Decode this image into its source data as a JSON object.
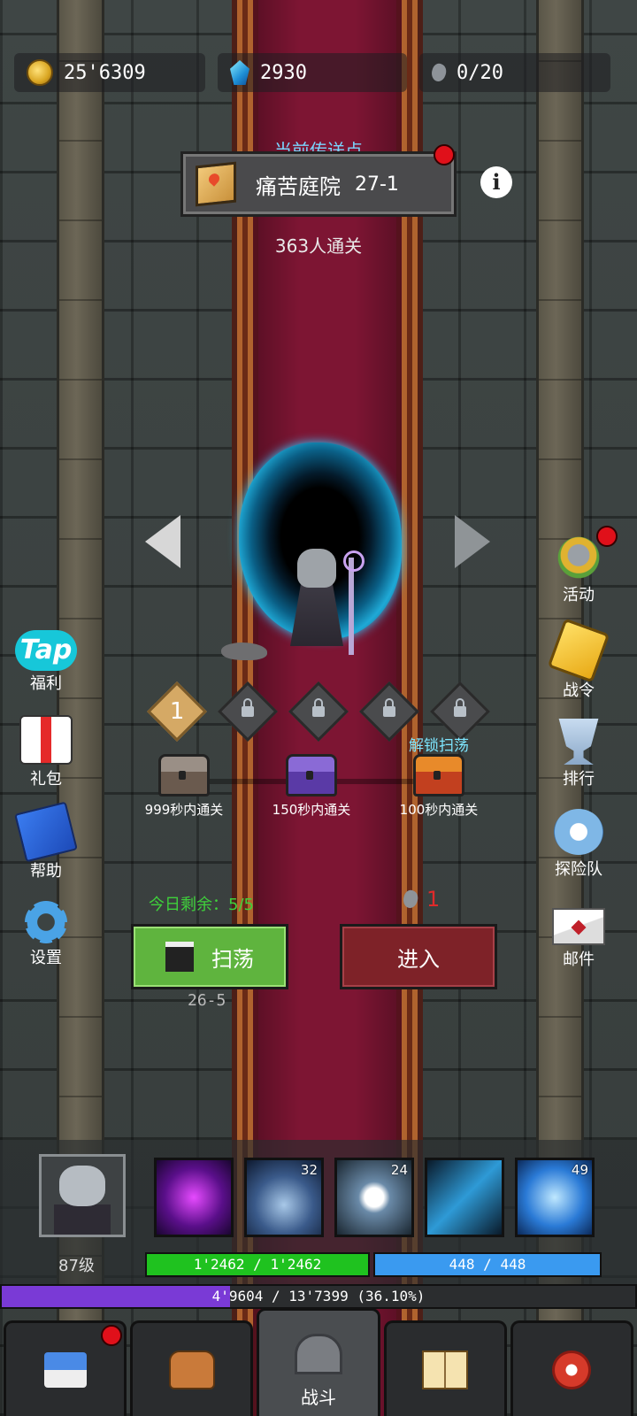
{
  "resources": {
    "gold": "25'6309",
    "gems": "2930",
    "stones": "0/20"
  },
  "teleport": {
    "title": "当前传送点",
    "name": "痛苦庭院",
    "stage": "27-1",
    "clears": "363人通关"
  },
  "stages": [
    {
      "label": "1",
      "locked": false
    },
    {
      "label": "",
      "locked": true
    },
    {
      "label": "",
      "locked": true
    },
    {
      "label": "",
      "locked": true
    },
    {
      "label": "",
      "locked": true
    }
  ],
  "chests": [
    {
      "label": "999秒内通关"
    },
    {
      "label": "150秒内通关"
    },
    {
      "label": "100秒内通关"
    }
  ],
  "unlock_sweep": "解锁扫荡",
  "left_menu": {
    "welfare": "福利",
    "tap_logo": "Tap",
    "gift": "礼包",
    "help": "帮助",
    "settings": "设置"
  },
  "right_menu": {
    "events": "活动",
    "battle_pass": "战令",
    "ranking": "排行",
    "team": "探险队",
    "mail": "邮件"
  },
  "action": {
    "remaining": "今日剩余：5/5",
    "cost": "1",
    "sweep": "扫荡",
    "enter": "进入",
    "sweep_stage": "26-5"
  },
  "player": {
    "level": "87级",
    "hp": "1'2462 / 1'2462",
    "mp": "448 / 448",
    "xp": "4'9604 / 13'7399 (36.10%)",
    "xp_fraction": 0.361
  },
  "skills": [
    {
      "icon": "purple-vortex-skill",
      "count": ""
    },
    {
      "icon": "twin-specters-skill",
      "count": "32"
    },
    {
      "icon": "white-orb-skill",
      "count": "24"
    },
    {
      "icon": "ice-shard-skill",
      "count": ""
    },
    {
      "icon": "ice-shower-skill",
      "count": "49"
    }
  ],
  "nav": {
    "battle": "战斗"
  }
}
